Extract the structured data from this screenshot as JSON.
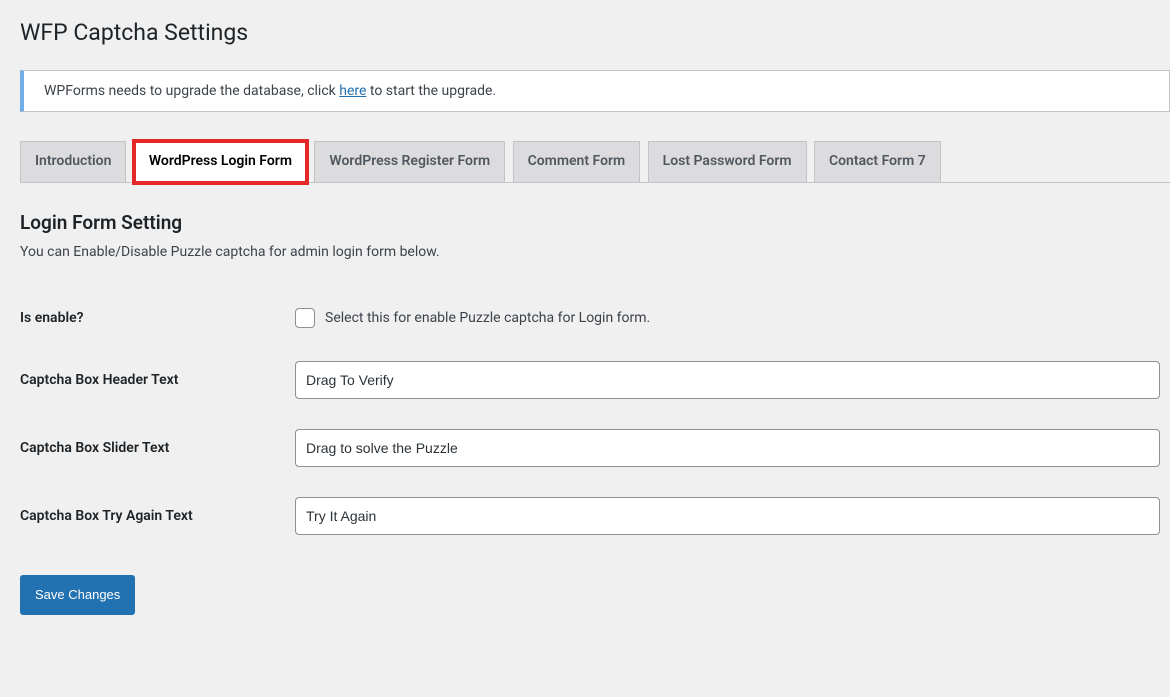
{
  "page_title": "WFP Captcha Settings",
  "notice": {
    "prefix": "WPForms needs to upgrade the database, click ",
    "link_text": "here",
    "suffix": " to start the upgrade."
  },
  "tabs": [
    {
      "label": "Introduction",
      "active": false,
      "highlighted": false
    },
    {
      "label": "WordPress Login Form",
      "active": true,
      "highlighted": true
    },
    {
      "label": "WordPress Register Form",
      "active": false,
      "highlighted": false
    },
    {
      "label": "Comment Form",
      "active": false,
      "highlighted": false
    },
    {
      "label": "Lost Password Form",
      "active": false,
      "highlighted": false
    },
    {
      "label": "Contact Form 7",
      "active": false,
      "highlighted": false
    }
  ],
  "section": {
    "heading": "Login Form Setting",
    "description": "You can Enable/Disable Puzzle captcha for admin login form below."
  },
  "fields": {
    "is_enable": {
      "label": "Is enable?",
      "checkbox_label": "Select this for enable Puzzle captcha for Login form.",
      "checked": false
    },
    "header_text": {
      "label": "Captcha Box Header Text",
      "value": "Drag To Verify"
    },
    "slider_text": {
      "label": "Captcha Box Slider Text",
      "value": "Drag to solve the Puzzle"
    },
    "try_again_text": {
      "label": "Captcha Box Try Again Text",
      "value": "Try It Again"
    }
  },
  "submit": {
    "label": "Save Changes"
  }
}
